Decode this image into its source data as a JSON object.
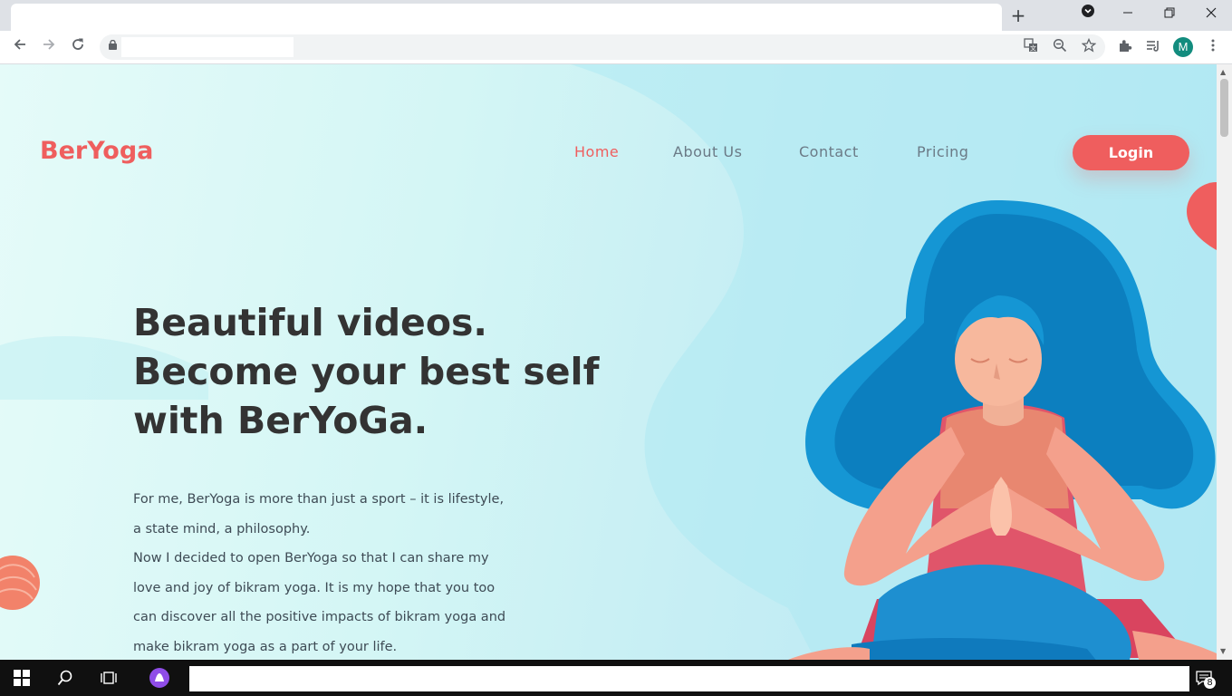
{
  "browser": {
    "new_tab_glyph": "+",
    "avatar_letter": "M",
    "icons": [
      "back-arrow-icon",
      "forward-arrow-icon",
      "reload-icon",
      "lock-icon",
      "translate-icon",
      "zoom-out-icon",
      "star-icon",
      "extensions-icon",
      "media-queue-icon",
      "menu-dots-icon"
    ]
  },
  "site": {
    "logo": "BerYoga",
    "nav": {
      "home": "Home",
      "about": "About Us",
      "contact": "Contact",
      "pricing": "Pricing"
    },
    "login_label": "Login",
    "headline": {
      "line1": "Beautiful videos.",
      "line2": "Become your best self",
      "line3": "with BerYoGa."
    },
    "body": {
      "l1": "For me, BerYoga is more than just a sport – it is lifestyle,",
      "l2": "a state mind, a philosophy.",
      "l3": "Now I decided to open BerYoga so that I can share my",
      "l4": "love and joy of bikram yoga. It is my hope that you too",
      "l5": "can discover all the positive impacts of bikram yoga and",
      "l6": "make bikram yoga as a part of your life."
    },
    "colors": {
      "accent": "#ef5e5e",
      "nav_text": "#6b7a86",
      "heading": "#333333",
      "hair": "#1f9fd6"
    }
  },
  "taskbar": {
    "notification_count": "8"
  }
}
